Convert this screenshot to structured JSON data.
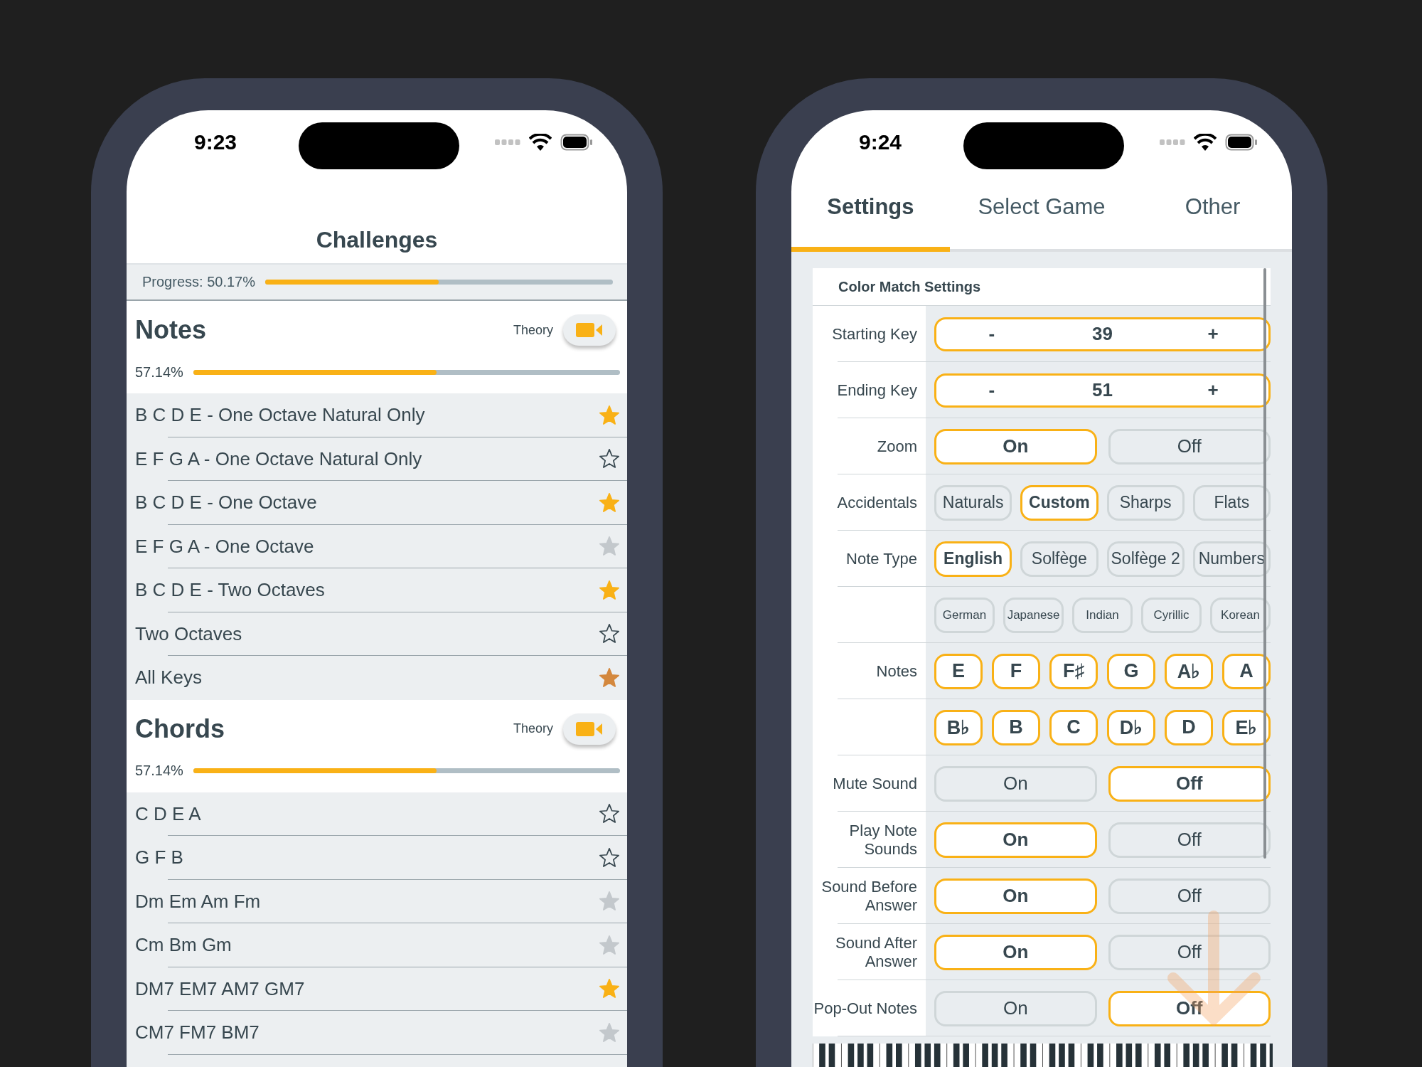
{
  "challenges_screen": {
    "status_bar": {
      "time": "9:23"
    },
    "title": "Challenges",
    "overall_progress": {
      "label": "Progress: 50.17%",
      "level": 0.5
    },
    "sections": [
      {
        "title": "Notes",
        "theory_label": "Theory",
        "percent": "57.14%",
        "level": 0.57,
        "challenges": [
          {
            "name": "B C D E - One Octave Natural Only",
            "starred": true,
            "color": "#f9b116"
          },
          {
            "name": "E F G A - One Octave Natural Only",
            "starred": false
          },
          {
            "name": "B C D E - One Octave",
            "starred": true,
            "color": "#f9b116"
          },
          {
            "name": "E F G A - One Octave",
            "starred": true,
            "color": "#c3c8cc"
          },
          {
            "name": "B C D E - Two Octaves",
            "starred": true,
            "color": "#f9b116"
          },
          {
            "name": "Two Octaves",
            "starred": false
          },
          {
            "name": "All Keys",
            "starred": true,
            "color": "#d4883e"
          }
        ]
      },
      {
        "title": "Chords",
        "theory_label": "Theory",
        "percent": "57.14%",
        "level": 0.57,
        "challenges": [
          {
            "name": "C D E A",
            "starred": false
          },
          {
            "name": "G F B",
            "starred": false
          },
          {
            "name": "Dm Em Am Fm",
            "starred": true,
            "color": "#c3c8cc"
          },
          {
            "name": "Cm Bm Gm",
            "starred": true,
            "color": "#c3c8cc"
          },
          {
            "name": "DM7 EM7 AM7 GM7",
            "starred": true,
            "color": "#f9b116"
          },
          {
            "name": "CM7 FM7 BM7",
            "starred": true,
            "color": "#c3c8cc"
          }
        ]
      }
    ]
  },
  "settings_screen": {
    "status_bar": {
      "time": "9:24"
    },
    "tabs": [
      {
        "label": "Settings",
        "selected": true
      },
      {
        "label": "Select Game",
        "selected": false
      },
      {
        "label": "Other",
        "selected": false
      }
    ],
    "card": {
      "title": "Color Match Settings",
      "rows": [
        {
          "kind": "stepper",
          "label": "Starting Key",
          "minus": "-",
          "value": "39",
          "plus": "+"
        },
        {
          "kind": "stepper",
          "label": "Ending Key",
          "minus": "-",
          "value": "51",
          "plus": "+"
        },
        {
          "kind": "choice",
          "label": "Zoom",
          "options": [
            {
              "label": "On",
              "selected": true
            },
            {
              "label": "Off",
              "selected": false
            }
          ]
        },
        {
          "kind": "choice",
          "label": "Accidentals",
          "options": [
            {
              "label": "Naturals",
              "selected": false
            },
            {
              "label": "Custom",
              "selected": true
            },
            {
              "label": "Sharps",
              "selected": false
            },
            {
              "label": "Flats",
              "selected": false
            }
          ]
        },
        {
          "kind": "choice",
          "label": "Note Type",
          "options": [
            {
              "label": "English",
              "selected": true
            },
            {
              "label": "Solfège",
              "selected": false
            },
            {
              "label": "Solfège 2",
              "selected": false
            },
            {
              "label": "Numbers",
              "selected": false
            }
          ]
        },
        {
          "kind": "choice",
          "options": [
            {
              "label": "German",
              "selected": false
            },
            {
              "label": "Japanese",
              "selected": false
            },
            {
              "label": "Indian",
              "selected": false
            },
            {
              "label": "Cyrillic",
              "selected": false
            },
            {
              "label": "Korean",
              "selected": false
            }
          ]
        },
        {
          "kind": "choice",
          "label": "Notes",
          "options": [
            {
              "label": "E",
              "selected": true
            },
            {
              "label": "F",
              "selected": true
            },
            {
              "label": "F♯",
              "selected": true
            },
            {
              "label": "G",
              "selected": true
            },
            {
              "label": "A♭",
              "selected": true
            },
            {
              "label": "A",
              "selected": true
            }
          ]
        },
        {
          "kind": "choice",
          "options": [
            {
              "label": "B♭",
              "selected": true
            },
            {
              "label": "B",
              "selected": true
            },
            {
              "label": "C",
              "selected": true
            },
            {
              "label": "D♭",
              "selected": true
            },
            {
              "label": "D",
              "selected": true
            },
            {
              "label": "E♭",
              "selected": true
            }
          ]
        },
        {
          "kind": "choice",
          "label": "Mute Sound",
          "options": [
            {
              "label": "On",
              "selected": false
            },
            {
              "label": "Off",
              "selected": true
            }
          ]
        },
        {
          "kind": "choice",
          "label": "Play Note Sounds",
          "options": [
            {
              "label": "On",
              "selected": true
            },
            {
              "label": "Off",
              "selected": false
            }
          ]
        },
        {
          "kind": "choice",
          "label": "Sound Before Answer",
          "options": [
            {
              "label": "On",
              "selected": true
            },
            {
              "label": "Off",
              "selected": false
            }
          ]
        },
        {
          "kind": "choice",
          "label": "Sound After Answer",
          "options": [
            {
              "label": "On",
              "selected": true
            },
            {
              "label": "Off",
              "selected": false
            }
          ]
        },
        {
          "kind": "choice",
          "label": "Pop-Out Notes",
          "options": [
            {
              "label": "On",
              "selected": false
            },
            {
              "label": "Off",
              "selected": true
            }
          ]
        }
      ]
    }
  }
}
